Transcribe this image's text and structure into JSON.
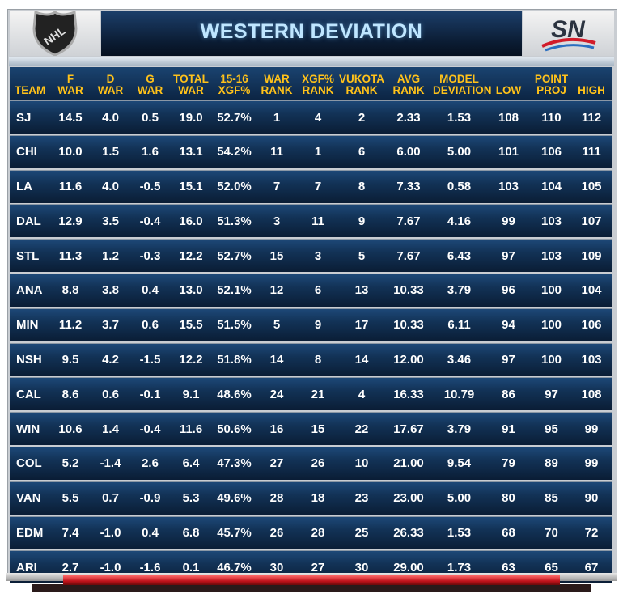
{
  "header": {
    "title": "WESTERN DEVIATION",
    "left_logo": "NHL",
    "right_logo": "SN"
  },
  "columns": [
    "TEAM",
    "F\nWAR",
    "D\nWAR",
    "G\nWAR",
    "TOTAL\nWAR",
    "15-16\nXGF%",
    "WAR\nRANK",
    "XGF%\nRANK",
    "VUKOTA\nRANK",
    "AVG\nRANK",
    "MODEL\nDEVIATION",
    "LOW",
    "POINT\nPROJ",
    "HIGH"
  ],
  "rows": [
    [
      "SJ",
      "14.5",
      "4.0",
      "0.5",
      "19.0",
      "52.7%",
      "1",
      "4",
      "2",
      "2.33",
      "1.53",
      "108",
      "110",
      "112"
    ],
    [
      "CHI",
      "10.0",
      "1.5",
      "1.6",
      "13.1",
      "54.2%",
      "11",
      "1",
      "6",
      "6.00",
      "5.00",
      "101",
      "106",
      "111"
    ],
    [
      "LA",
      "11.6",
      "4.0",
      "-0.5",
      "15.1",
      "52.0%",
      "7",
      "7",
      "8",
      "7.33",
      "0.58",
      "103",
      "104",
      "105"
    ],
    [
      "DAL",
      "12.9",
      "3.5",
      "-0.4",
      "16.0",
      "51.3%",
      "3",
      "11",
      "9",
      "7.67",
      "4.16",
      "99",
      "103",
      "107"
    ],
    [
      "STL",
      "11.3",
      "1.2",
      "-0.3",
      "12.2",
      "52.7%",
      "15",
      "3",
      "5",
      "7.67",
      "6.43",
      "97",
      "103",
      "109"
    ],
    [
      "ANA",
      "8.8",
      "3.8",
      "0.4",
      "13.0",
      "52.1%",
      "12",
      "6",
      "13",
      "10.33",
      "3.79",
      "96",
      "100",
      "104"
    ],
    [
      "MIN",
      "11.2",
      "3.7",
      "0.6",
      "15.5",
      "51.5%",
      "5",
      "9",
      "17",
      "10.33",
      "6.11",
      "94",
      "100",
      "106"
    ],
    [
      "NSH",
      "9.5",
      "4.2",
      "-1.5",
      "12.2",
      "51.8%",
      "14",
      "8",
      "14",
      "12.00",
      "3.46",
      "97",
      "100",
      "103"
    ],
    [
      "CAL",
      "8.6",
      "0.6",
      "-0.1",
      "9.1",
      "48.6%",
      "24",
      "21",
      "4",
      "16.33",
      "10.79",
      "86",
      "97",
      "108"
    ],
    [
      "WIN",
      "10.6",
      "1.4",
      "-0.4",
      "11.6",
      "50.6%",
      "16",
      "15",
      "22",
      "17.67",
      "3.79",
      "91",
      "95",
      "99"
    ],
    [
      "COL",
      "5.2",
      "-1.4",
      "2.6",
      "6.4",
      "47.3%",
      "27",
      "26",
      "10",
      "21.00",
      "9.54",
      "79",
      "89",
      "99"
    ],
    [
      "VAN",
      "5.5",
      "0.7",
      "-0.9",
      "5.3",
      "49.6%",
      "28",
      "18",
      "23",
      "23.00",
      "5.00",
      "80",
      "85",
      "90"
    ],
    [
      "EDM",
      "7.4",
      "-1.0",
      "0.4",
      "6.8",
      "45.7%",
      "26",
      "28",
      "25",
      "26.33",
      "1.53",
      "68",
      "70",
      "72"
    ],
    [
      "ARI",
      "2.7",
      "-1.0",
      "-1.6",
      "0.1",
      "46.7%",
      "30",
      "27",
      "30",
      "29.00",
      "1.73",
      "63",
      "65",
      "67"
    ]
  ],
  "colors": {
    "header_text": "#ffc21a",
    "title_text": "#bfe6ff",
    "row_bg": "#123256",
    "accent_red": "#c0121a"
  }
}
